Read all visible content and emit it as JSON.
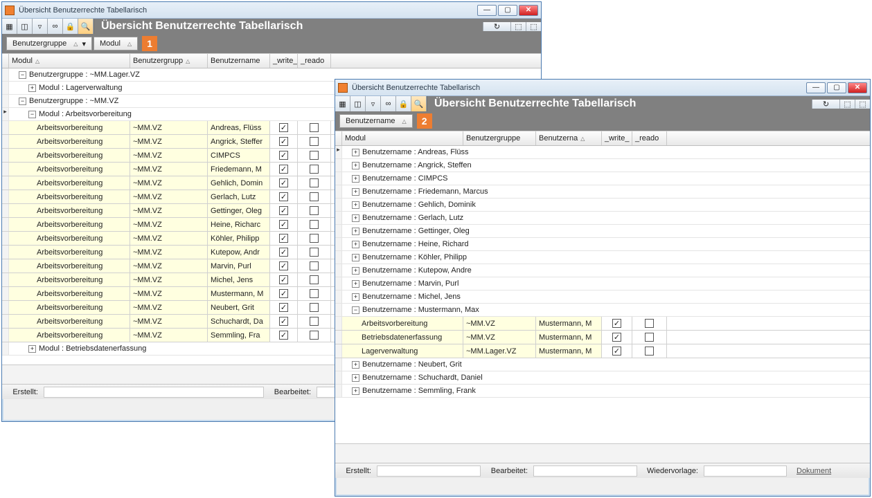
{
  "window_title": "Übersicht Benutzerrechte Tabellarisch",
  "toolbar_title": "Übersicht Benutzerrechte Tabellarisch",
  "columns": {
    "modul": "Modul",
    "gruppe": "Benutzergrupp",
    "name": "Benutzername",
    "write": "_write_",
    "read": "_reado"
  },
  "columns2": {
    "modul": "Modul",
    "gruppe": "Benutzergruppe",
    "name": "Benutzerna",
    "write": "_write_",
    "read": "_reado"
  },
  "chips1": {
    "a": "Benutzergruppe",
    "b": "Modul"
  },
  "chips2": {
    "a": "Benutzername"
  },
  "callout1": "1",
  "callout2": "2",
  "w1": {
    "groups": [
      {
        "type": "group",
        "indent": 14,
        "exp": "-",
        "label": "Benutzergruppe : ~MM.Lager.VZ"
      },
      {
        "type": "group",
        "indent": 28,
        "exp": "+",
        "label": "Modul : Lagerverwaltung"
      },
      {
        "type": "group",
        "indent": 14,
        "exp": "-",
        "label": "Benutzergruppe : ~MM.VZ"
      },
      {
        "type": "group",
        "indent": 28,
        "exp": "-",
        "label": "Modul : Arbeitsvorbereitung",
        "arrow": true
      }
    ],
    "rows": [
      {
        "mod": "Arbeitsvorbereitung",
        "grp": "~MM.VZ",
        "usr": "Andreas, Flüss",
        "w": true,
        "r": false
      },
      {
        "mod": "Arbeitsvorbereitung",
        "grp": "~MM.VZ",
        "usr": "Angrick, Steffer",
        "w": true,
        "r": false
      },
      {
        "mod": "Arbeitsvorbereitung",
        "grp": "~MM.VZ",
        "usr": "CIMPCS",
        "w": true,
        "r": false
      },
      {
        "mod": "Arbeitsvorbereitung",
        "grp": "~MM.VZ",
        "usr": "Friedemann, M",
        "w": true,
        "r": false
      },
      {
        "mod": "Arbeitsvorbereitung",
        "grp": "~MM.VZ",
        "usr": "Gehlich, Domin",
        "w": true,
        "r": false
      },
      {
        "mod": "Arbeitsvorbereitung",
        "grp": "~MM.VZ",
        "usr": "Gerlach, Lutz",
        "w": true,
        "r": false
      },
      {
        "mod": "Arbeitsvorbereitung",
        "grp": "~MM.VZ",
        "usr": "Gettinger, Oleg",
        "w": true,
        "r": false
      },
      {
        "mod": "Arbeitsvorbereitung",
        "grp": "~MM.VZ",
        "usr": "Heine, Richarc",
        "w": true,
        "r": false
      },
      {
        "mod": "Arbeitsvorbereitung",
        "grp": "~MM.VZ",
        "usr": "Köhler, Philipp",
        "w": true,
        "r": false
      },
      {
        "mod": "Arbeitsvorbereitung",
        "grp": "~MM.VZ",
        "usr": "Kutepow, Andr",
        "w": true,
        "r": false
      },
      {
        "mod": "Arbeitsvorbereitung",
        "grp": "~MM.VZ",
        "usr": "Marvin, Purl",
        "w": true,
        "r": false
      },
      {
        "mod": "Arbeitsvorbereitung",
        "grp": "~MM.VZ",
        "usr": "Michel, Jens",
        "w": true,
        "r": false
      },
      {
        "mod": "Arbeitsvorbereitung",
        "grp": "~MM.VZ",
        "usr": "Mustermann, M",
        "w": true,
        "r": false
      },
      {
        "mod": "Arbeitsvorbereitung",
        "grp": "~MM.VZ",
        "usr": "Neubert, Grit",
        "w": true,
        "r": false
      },
      {
        "mod": "Arbeitsvorbereitung",
        "grp": "~MM.VZ",
        "usr": "Schuchardt, Da",
        "w": true,
        "r": false
      },
      {
        "mod": "Arbeitsvorbereitung",
        "grp": "~MM.VZ",
        "usr": "Semmling, Fra",
        "w": true,
        "r": false
      }
    ],
    "after": [
      {
        "type": "group",
        "indent": 28,
        "exp": "+",
        "label": "Modul : Betriebsdatenerfassung"
      }
    ]
  },
  "w2": {
    "groups": [
      {
        "exp": "+",
        "label": "Benutzername : Andreas, Flüss",
        "arrow": true
      },
      {
        "exp": "+",
        "label": "Benutzername : Angrick, Steffen"
      },
      {
        "exp": "+",
        "label": "Benutzername : CIMPCS"
      },
      {
        "exp": "+",
        "label": "Benutzername : Friedemann, Marcus"
      },
      {
        "exp": "+",
        "label": "Benutzername : Gehlich, Dominik"
      },
      {
        "exp": "+",
        "label": "Benutzername : Gerlach, Lutz"
      },
      {
        "exp": "+",
        "label": "Benutzername : Gettinger, Oleg"
      },
      {
        "exp": "+",
        "label": "Benutzername : Heine, Richard"
      },
      {
        "exp": "+",
        "label": "Benutzername : Köhler, Philipp"
      },
      {
        "exp": "+",
        "label": "Benutzername : Kutepow, Andre"
      },
      {
        "exp": "+",
        "label": "Benutzername : Marvin, Purl"
      },
      {
        "exp": "+",
        "label": "Benutzername : Michel, Jens"
      },
      {
        "exp": "-",
        "label": "Benutzername : Mustermann, Max"
      }
    ],
    "rows": [
      {
        "mod": "Arbeitsvorbereitung",
        "grp": "~MM.VZ",
        "usr": "Mustermann, M",
        "w": true,
        "r": false
      },
      {
        "mod": "Betriebsdatenerfassung",
        "grp": "~MM.VZ",
        "usr": "Mustermann, M",
        "w": true,
        "r": false
      },
      {
        "mod": "Lagerverwaltung",
        "grp": "~MM.Lager.VZ",
        "usr": "Mustermann, M",
        "w": true,
        "r": false
      }
    ],
    "after": [
      {
        "exp": "+",
        "label": "Benutzername : Neubert, Grit"
      },
      {
        "exp": "+",
        "label": "Benutzername : Schuchardt, Daniel"
      },
      {
        "exp": "+",
        "label": "Benutzername : Semmling, Frank"
      }
    ]
  },
  "status": {
    "erstellt": "Erstellt:",
    "bearbeitet": "Bearbeitet:",
    "wiedervorlage": "Wiedervorlage:",
    "dokument": "Dokument"
  }
}
